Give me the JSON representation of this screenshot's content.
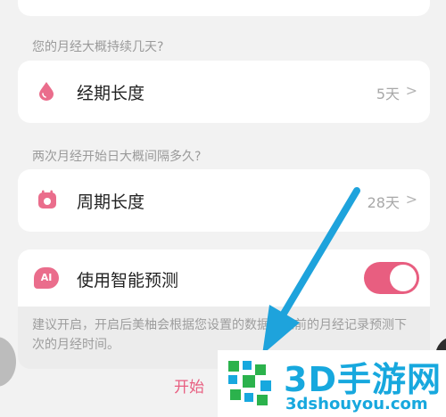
{
  "settings": {
    "period_question": "您的月经大概持续几天?",
    "period_length": {
      "label": "经期长度",
      "value": "5天",
      "chevron": ">"
    },
    "cycle_question": "两次月经开始日大概间隔多久?",
    "cycle_length": {
      "label": "周期长度",
      "value": "28天",
      "chevron": ">"
    },
    "smart_prediction": {
      "label": "使用智能预测",
      "icon_text": "AI",
      "enabled": true
    },
    "hint": "建议开启，开启后美柚会根据您设置的数据和之前的月经记录预测下次的月经时间。",
    "start_button": "开始"
  },
  "icons": {
    "period": "drop-icon",
    "cycle": "calendar-icon",
    "smart": "ai-icon"
  },
  "colors": {
    "accent": "#e85e80",
    "icon_pink": "#ea6d8c",
    "annotation_arrow": "#1ea3dc",
    "watermark_blue": "#17a8de"
  },
  "watermark": {
    "title": "3D手游网",
    "url": "3dshouyou.com"
  }
}
